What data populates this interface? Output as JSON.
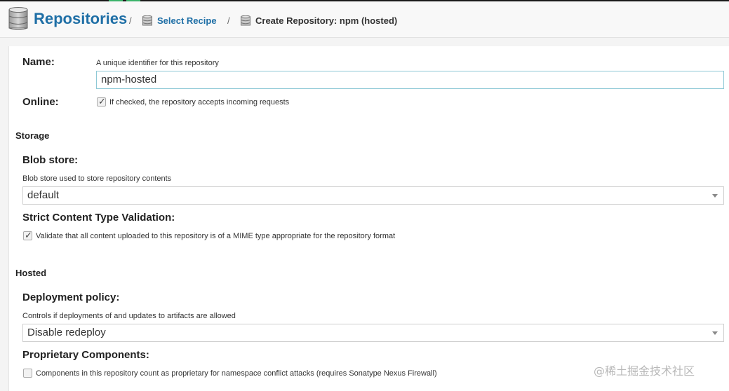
{
  "header": {
    "title": "Repositories",
    "separator": "/",
    "crumb_select_recipe": "Select Recipe",
    "crumb_current": "Create Repository: npm (hosted)"
  },
  "form": {
    "name": {
      "label": "Name:",
      "help": "A unique identifier for this repository",
      "value": "npm-hosted"
    },
    "online": {
      "label": "Online:",
      "checked": true,
      "checkbox_label": "If checked, the repository accepts incoming requests"
    },
    "storage_section": "Storage",
    "blob_store": {
      "label": "Blob store:",
      "help": "Blob store used to store repository contents",
      "value": "default"
    },
    "strict_validation": {
      "label": "Strict Content Type Validation:",
      "checked": true,
      "checkbox_label": "Validate that all content uploaded to this repository is of a MIME type appropriate for the repository format"
    },
    "hosted_section": "Hosted",
    "deployment_policy": {
      "label": "Deployment policy:",
      "help": "Controls if deployments of and updates to artifacts are allowed",
      "value": "Disable redeploy"
    },
    "proprietary": {
      "label": "Proprietary Components:",
      "checked": false,
      "checkbox_label": "Components in this repository count as proprietary for namespace conflict attacks (requires Sonatype Nexus Firewall)"
    }
  },
  "watermark": "@稀土掘金技术社区",
  "icons": {
    "header": "database-icon",
    "crumb": "database-icon"
  },
  "colors": {
    "accent": "#1f6fa6",
    "input_focus_border": "#8fc9d6"
  }
}
